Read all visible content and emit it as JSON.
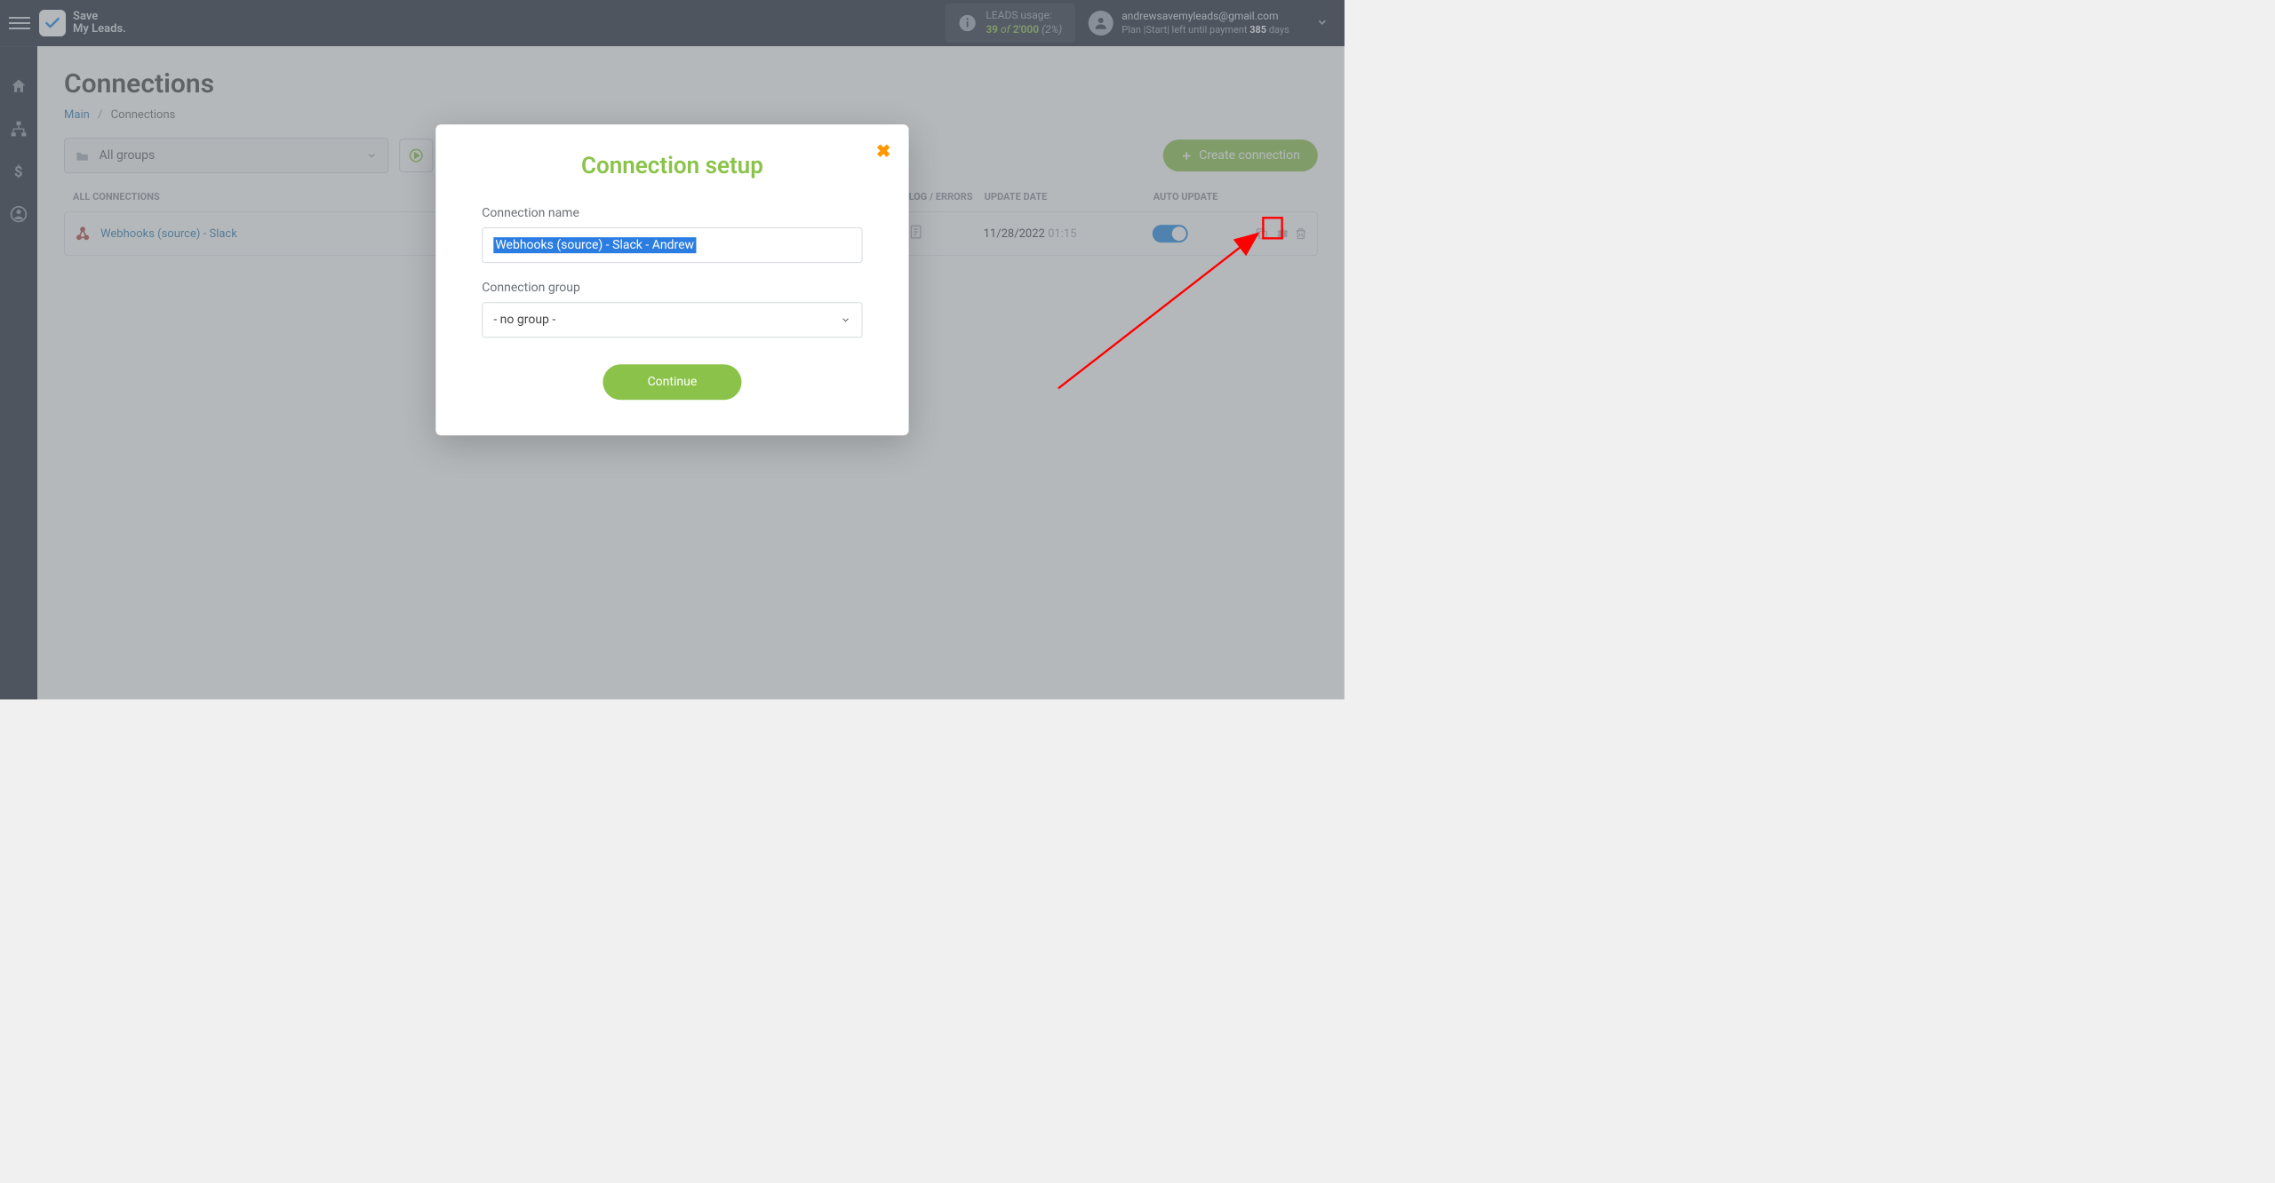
{
  "brand": {
    "line1": "Save",
    "line2": "My Leads."
  },
  "usage": {
    "label": "LEADS usage:",
    "count": "39",
    "of": "of",
    "total": "2'000",
    "pct": "(2%)"
  },
  "user": {
    "email": "andrewsavemyleads@gmail.com",
    "plan_prefix": "Plan |Start| left until payment ",
    "days_num": "385",
    "days_suffix": " days"
  },
  "page": {
    "title": "Connections",
    "breadcrumb_main": "Main",
    "breadcrumb_current": "Connections"
  },
  "toolbar": {
    "group_label": "All groups",
    "create_label": "Create connection"
  },
  "table": {
    "col_name": "ALL CONNECTIONS",
    "col_log": "LOG / ERRORS",
    "col_date": "UPDATE DATE",
    "col_auto": "AUTO UPDATE",
    "rows": [
      {
        "name": "Webhooks (source) - Slack",
        "date": "11/28/2022",
        "time": "01:15"
      }
    ]
  },
  "modal": {
    "title": "Connection setup",
    "name_label": "Connection name",
    "name_value": "Webhooks (source) - Slack - Andrew",
    "group_label": "Connection group",
    "group_value": "- no group -",
    "continue": "Continue"
  }
}
